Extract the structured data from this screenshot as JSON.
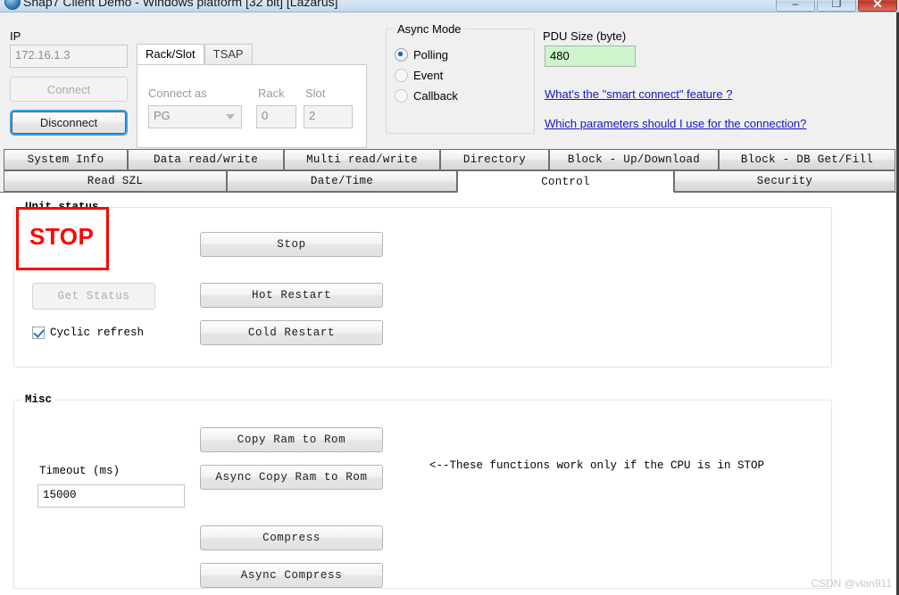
{
  "window": {
    "title": "Snap7 Client Demo - Windows platform [32 bit] [Lazarus]",
    "icon": "app-globe-icon",
    "buttons": {
      "minimize": "–",
      "maximize": "❐",
      "close": "✕"
    }
  },
  "connection": {
    "ip_label": "IP",
    "ip_value": "172.16.1.3",
    "connect_label": "Connect",
    "disconnect_label": "Disconnect"
  },
  "conn_tabs": {
    "tabs": [
      {
        "label": "Rack/Slot",
        "active": true
      },
      {
        "label": "TSAP",
        "active": false
      }
    ],
    "connect_as_label": "Connect as",
    "connect_as_value": "PG",
    "rack_label": "Rack",
    "rack_value": "0",
    "slot_label": "Slot",
    "slot_value": "2"
  },
  "async_mode": {
    "group_label": "Async Mode",
    "options": [
      {
        "label": "Polling",
        "selected": true
      },
      {
        "label": "Event",
        "selected": false
      },
      {
        "label": "Callback",
        "selected": false
      }
    ]
  },
  "pdu": {
    "label": "PDU Size (byte)",
    "value": "480",
    "field_color": "#ccf5cc"
  },
  "links": [
    "What's the \"smart connect\" feature ?",
    "Which parameters should I use for the connection?"
  ],
  "tabstrip": {
    "row1": [
      {
        "label": "System Info",
        "active": false
      },
      {
        "label": "Data read/write",
        "active": false
      },
      {
        "label": "Multi read/write",
        "active": false
      },
      {
        "label": "Directory",
        "active": false
      },
      {
        "label": "Block - Up/Download",
        "active": false
      },
      {
        "label": "Block - DB Get/Fill",
        "active": false
      }
    ],
    "row2": [
      {
        "label": "Read SZL",
        "active": false
      },
      {
        "label": "Date/Time",
        "active": false
      },
      {
        "label": "Control",
        "active": true
      },
      {
        "label": "Security",
        "active": false
      }
    ]
  },
  "unit_status": {
    "group_label": "Unit status",
    "status_text": "STOP",
    "status_color": "#ff0000",
    "get_status_label": "Get Status",
    "cyclic_refresh_label": "Cyclic refresh",
    "cyclic_refresh_checked": true,
    "buttons": [
      "Stop",
      "Hot Restart",
      "Cold Restart"
    ]
  },
  "misc": {
    "group_label": "Misc",
    "timeout_label": "Timeout (ms)",
    "timeout_value": "15000",
    "buttons": [
      "Copy Ram to Rom",
      "Async Copy Ram to Rom",
      "Compress",
      "Async Compress"
    ],
    "hint": "<--These functions work only if the CPU is in STOP"
  },
  "watermark": "CSDN @vlan911"
}
